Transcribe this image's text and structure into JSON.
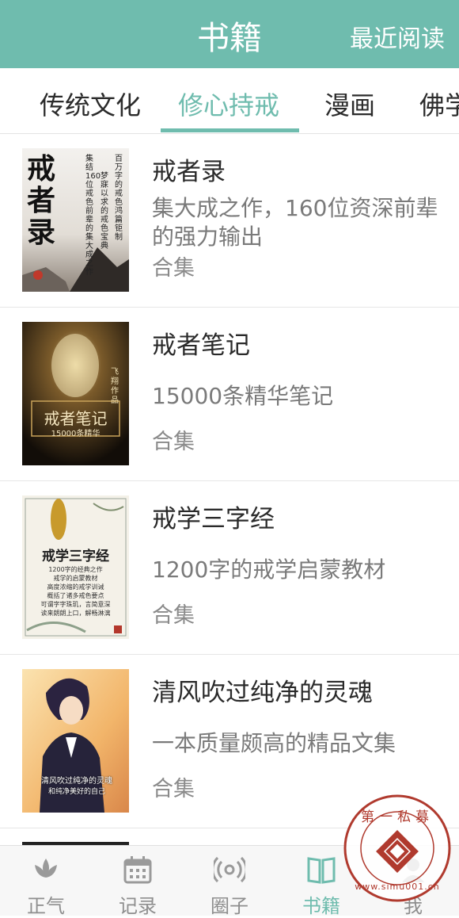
{
  "header": {
    "title": "书籍",
    "recent": "最近阅读"
  },
  "tabs": [
    {
      "label": "传统文化",
      "active": false
    },
    {
      "label": "修心持戒",
      "active": true
    },
    {
      "label": "漫画",
      "active": false
    },
    {
      "label": "佛学",
      "active": false
    }
  ],
  "books": [
    {
      "title": "戒者录",
      "desc": "集大成之作，160位资深前辈的强力输出",
      "tag": "合集",
      "cover": {
        "main": "戒者录",
        "side": [
          "集结160位戒色前辈的集大成之作",
          "百万字的戒色鸿篇钜制",
          "梦寐以求的戒色宝典"
        ]
      }
    },
    {
      "title": "戒者笔记",
      "desc": "15000条精华笔记",
      "tag": "合集",
      "cover": {
        "main": "戒者笔记",
        "sub": "15000条精华",
        "side": [
          "飞翔作品"
        ]
      }
    },
    {
      "title": "戒学三字经",
      "desc": "1200字的戒学启蒙教材",
      "tag": "合集",
      "cover": {
        "main": "戒学三字经",
        "lines": [
          "1200字的经典之作",
          "戒学的启蒙教材",
          "高度浓缩的戒学训诫",
          "概括了诸多戒色要点",
          "可谓字字珠玑，言简意深",
          "读来朗朗上口，解畅淋漓"
        ]
      }
    },
    {
      "title": "清风吹过纯净的灵魂",
      "desc": "一本质量颇高的精品文集",
      "tag": "合集",
      "cover": {
        "main": "清风吹过纯净的灵魂",
        "sub": "和纯净美好的自己"
      }
    }
  ],
  "bottom_nav": [
    {
      "label": "正气",
      "icon": "lotus-icon",
      "active": false
    },
    {
      "label": "记录",
      "icon": "calendar-icon",
      "active": false
    },
    {
      "label": "圈子",
      "icon": "broadcast-icon",
      "active": false
    },
    {
      "label": "书籍",
      "icon": "book-icon",
      "active": true
    },
    {
      "label": "我",
      "icon": "user-icon",
      "active": false
    }
  ],
  "watermark": {
    "text": "第一私募",
    "url": "www.simu001.cn"
  },
  "colors": {
    "accent": "#6fbcae",
    "text": "#2e2e2e",
    "muted": "#7a7a7a"
  }
}
